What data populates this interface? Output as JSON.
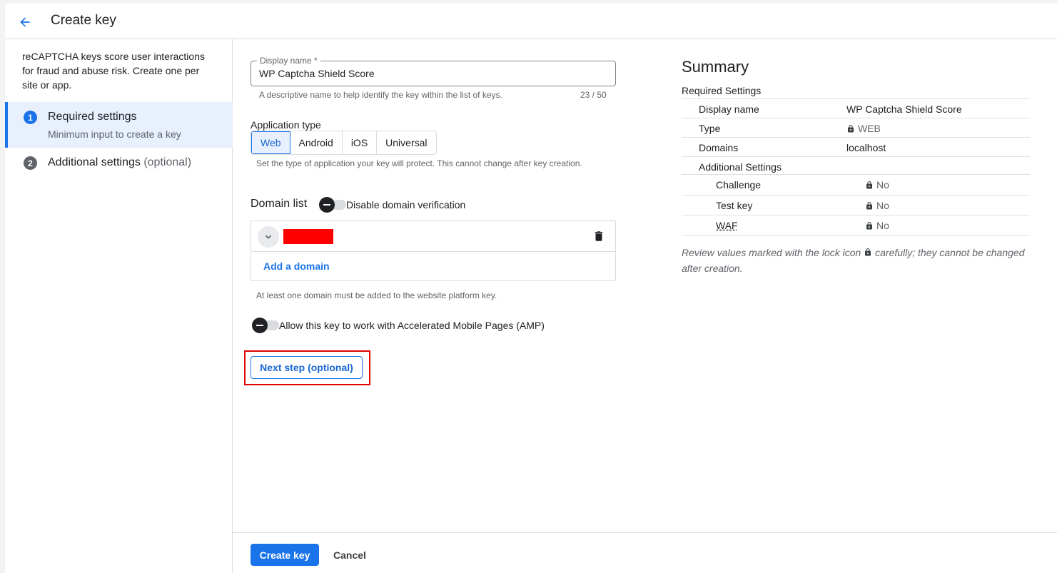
{
  "header": {
    "title": "Create key",
    "back_icon": "arrow-back-icon",
    "accent": "#1a73e8"
  },
  "stepper": {
    "intro": "reCAPTCHA keys score user interactions for fraud and abuse risk. Create one per site or app.",
    "steps": [
      {
        "number": "1",
        "title": "Required settings",
        "subtitle": "Minimum input to create a key",
        "active": true
      },
      {
        "number": "2",
        "title": "Additional settings",
        "optional": "(optional)",
        "active": false
      }
    ]
  },
  "form": {
    "display_name": {
      "label": "Display name *",
      "value": "WP Captcha Shield Score",
      "hint": "A descriptive name to help identify the key within the list of keys.",
      "counter": "23 / 50"
    },
    "application_type": {
      "label": "Application type",
      "options": [
        "Web",
        "Android",
        "iOS",
        "Universal"
      ],
      "selected": "Web",
      "hint": "Set the type of application your key will protect. This cannot change after key creation."
    },
    "domain_list": {
      "label": "Domain list",
      "toggle_label": "Disable domain verification",
      "add_label": "Add a domain",
      "hint": "At least one domain must be added to the website platform key."
    },
    "amp_toggle_label": "Allow this key to work with Accelerated Mobile Pages (AMP)",
    "next_button": "Next step (optional)"
  },
  "summary": {
    "title": "Summary",
    "required_heading": "Required Settings",
    "rows": [
      {
        "key": "Display name",
        "value": "WP Captcha Shield Score",
        "locked": false
      },
      {
        "key": "Type",
        "value": "WEB",
        "locked": true
      },
      {
        "key": "Domains",
        "value": "localhost",
        "locked": false
      }
    ],
    "additional_heading": "Additional Settings",
    "additional_rows": [
      {
        "key": "Challenge",
        "value": "No",
        "locked": true
      },
      {
        "key": "Test key",
        "value": "No",
        "locked": true
      },
      {
        "key": "WAF",
        "value": "No",
        "locked": true
      }
    ],
    "note_before": "Review values marked with the lock icon",
    "note_after": "carefully; they cannot be changed after creation."
  },
  "footer": {
    "create_label": "Create key",
    "cancel_label": "Cancel"
  }
}
